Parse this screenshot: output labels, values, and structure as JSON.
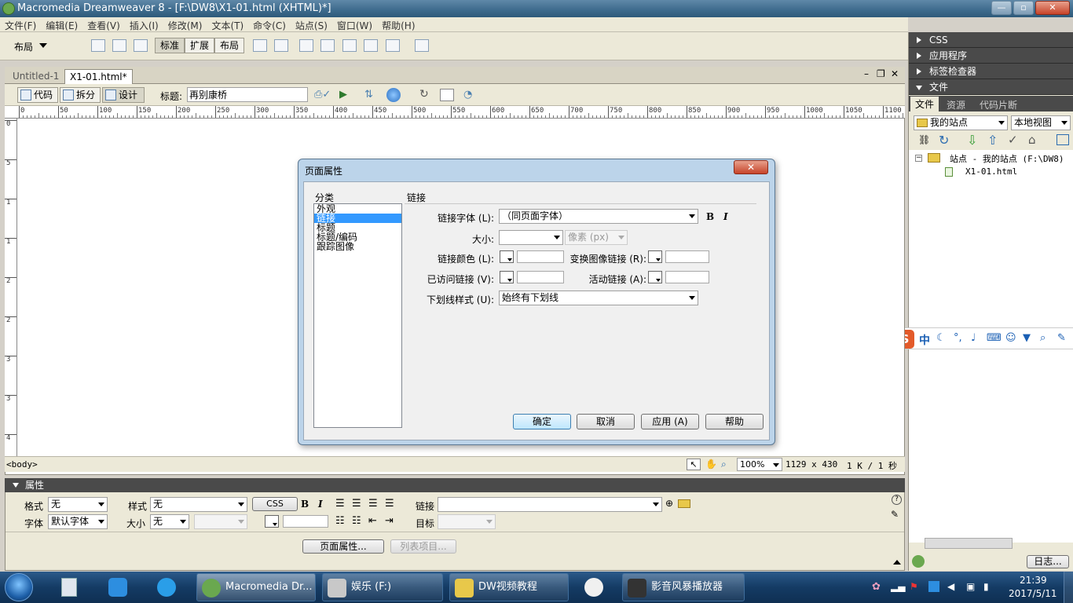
{
  "window": {
    "title": "Macromedia Dreamweaver 8 - [F:\\DW8\\X1-01.html (XHTML)*]"
  },
  "menu": [
    "文件(F)",
    "编辑(E)",
    "查看(V)",
    "插入(I)",
    "修改(M)",
    "文本(T)",
    "命令(C)",
    "站点(S)",
    "窗口(W)",
    "帮助(H)"
  ],
  "toolbar": {
    "layout_dropdown": "布局",
    "seg_standard": "标准",
    "seg_expand": "扩展",
    "seg_layout": "布局"
  },
  "doc": {
    "tabs": [
      "Untitled-1",
      "X1-01.html*"
    ],
    "view_code": "代码",
    "view_split": "拆分",
    "view_design": "设计",
    "title_label": "标题:",
    "title_value": "再别康桥"
  },
  "ruler": {
    "h_labels": [
      "0",
      "50",
      "100",
      "150",
      "200",
      "250",
      "300",
      "350",
      "400",
      "450",
      "500",
      "550",
      "600",
      "650",
      "700",
      "750",
      "800",
      "850",
      "900",
      "950",
      "1000",
      "1050",
      "1100"
    ],
    "v_labels": [
      "0",
      "5",
      "1",
      "1",
      "2",
      "2",
      "3",
      "3",
      "4"
    ]
  },
  "status": {
    "tag": "<body>",
    "zoom": "100%",
    "size": "1129 x 430",
    "file": "1 K / 1 秒"
  },
  "dialog": {
    "title": "页面属性",
    "category_label": "分类",
    "categories": [
      "外观",
      "链接",
      "标题",
      "标题/编码",
      "跟踪图像"
    ],
    "selected_category": 1,
    "section_title": "链接",
    "link_font_label": "链接字体 (L):",
    "link_font_value": "（同页面字体）",
    "bold": "B",
    "italic": "I",
    "size_label": "大小:",
    "size_unit": "像素 (px)",
    "link_color_label": "链接颜色 (L):",
    "rollover_label": "变换图像链接 (R):",
    "visited_label": "已访问链接 (V):",
    "active_label": "活动链接 (A):",
    "underline_label": "下划线样式 (U):",
    "underline_value": "始终有下划线",
    "ok": "确定",
    "cancel": "取消",
    "apply": "应用 (A)",
    "help": "帮助"
  },
  "rpanel": {
    "css": "CSS",
    "app": "应用程序",
    "tag_inspector": "标签检查器",
    "files": "文件",
    "file_tabs": [
      "文件",
      "资源",
      "代码片断"
    ],
    "site_select": "我的站点",
    "view_select": "本地视图",
    "tree_root": "站点 - 我的站点 (F:\\DW8)",
    "tree_file": "X1-01.html",
    "log_button": "日志..."
  },
  "props": {
    "header": "属性",
    "format_label": "格式",
    "format_value": "无",
    "style_label": "样式",
    "style_value": "无",
    "css_button": "CSS",
    "bold": "B",
    "italic": "I",
    "link_label": "链接",
    "font_label": "字体",
    "font_value": "默认字体",
    "size_label": "大小",
    "size_value": "无",
    "target_label": "目标",
    "page_props_button": "页面属性...",
    "list_item_button": "列表项目..."
  },
  "taskbar": {
    "tasks": [
      "Macromedia Dr...",
      "娱乐 (F:)",
      "DW视频教程",
      "影音风暴播放器"
    ],
    "time": "21:39",
    "date": "2017/5/11"
  },
  "ime": {
    "zh": "中"
  },
  "colors": {
    "selection": "#3399ff",
    "panel_header": "#4a4a4a",
    "taskbar": "#143b64"
  }
}
